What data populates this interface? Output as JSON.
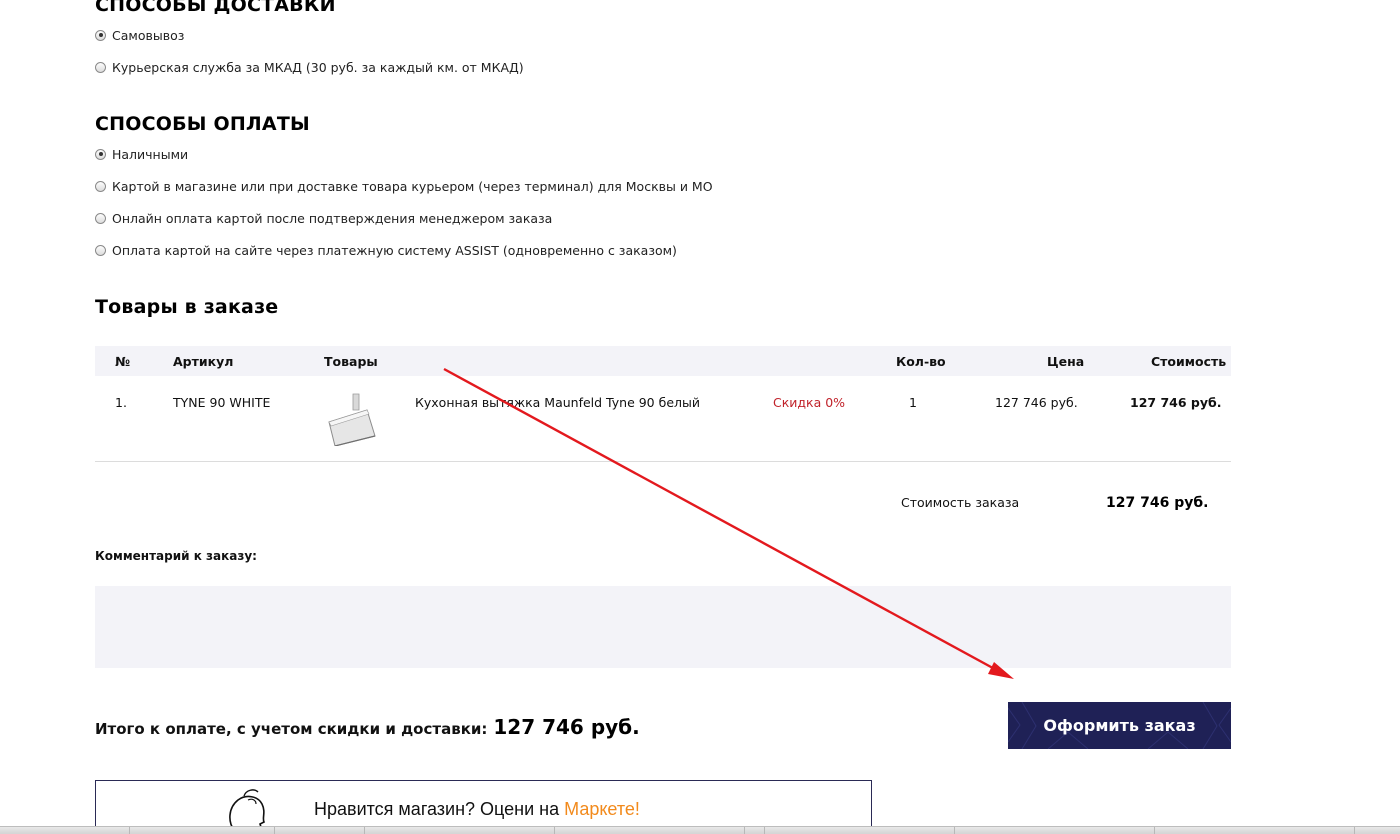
{
  "delivery": {
    "title": "СПОСОБЫ ДОСТАВКИ",
    "options": [
      {
        "label": "Самовывоз",
        "selected": true
      },
      {
        "label": "Курьерская служба за МКАД (30 руб. за каждый км. от МКАД)",
        "selected": false
      }
    ]
  },
  "payment": {
    "title": "СПОСОБЫ ОПЛАТЫ",
    "options": [
      {
        "label": "Наличными",
        "selected": true
      },
      {
        "label": "Картой в магазине или при доставке товара курьером (через терминал) для Москвы и МО",
        "selected": false
      },
      {
        "label": "Онлайн оплата картой после подтверждения менеджером заказа",
        "selected": false
      },
      {
        "label": "Оплата картой на сайте через платежную систему ASSIST (одновременно с заказом)",
        "selected": false
      }
    ]
  },
  "order_items": {
    "title": "Товары в заказе",
    "columns": {
      "num": "№",
      "sku": "Артикул",
      "product": "Товары",
      "qty": "Кол-во",
      "price": "Цена",
      "cost": "Стоимость"
    },
    "rows": [
      {
        "num": "1.",
        "sku": "TYNE 90 WHITE",
        "image": "range-hood-image",
        "name": "Кухонная вытяжка Maunfeld Tyne 90 белый",
        "discount": "Скидка 0%",
        "qty": "1",
        "price": "127 746 руб.",
        "cost": "127 746 руб."
      }
    ]
  },
  "summary": {
    "order_cost_label": "Стоимость заказа",
    "order_cost_value": "127 746 руб."
  },
  "comment": {
    "label": "Комментарий к заказу:",
    "value": ""
  },
  "total": {
    "label": "Итого к оплате, с учетом скидки и доставки:",
    "amount": "127 746 руб."
  },
  "submit": {
    "label": "Оформить заказ"
  },
  "rate_banner": {
    "text": "Нравится магазин? Оцени на ",
    "link": "Маркете!"
  },
  "colors": {
    "button_bg": "#1f2156",
    "discount": "#c0222a",
    "accent_link": "#f28a1c",
    "annotation_arrow": "#e3191e"
  }
}
